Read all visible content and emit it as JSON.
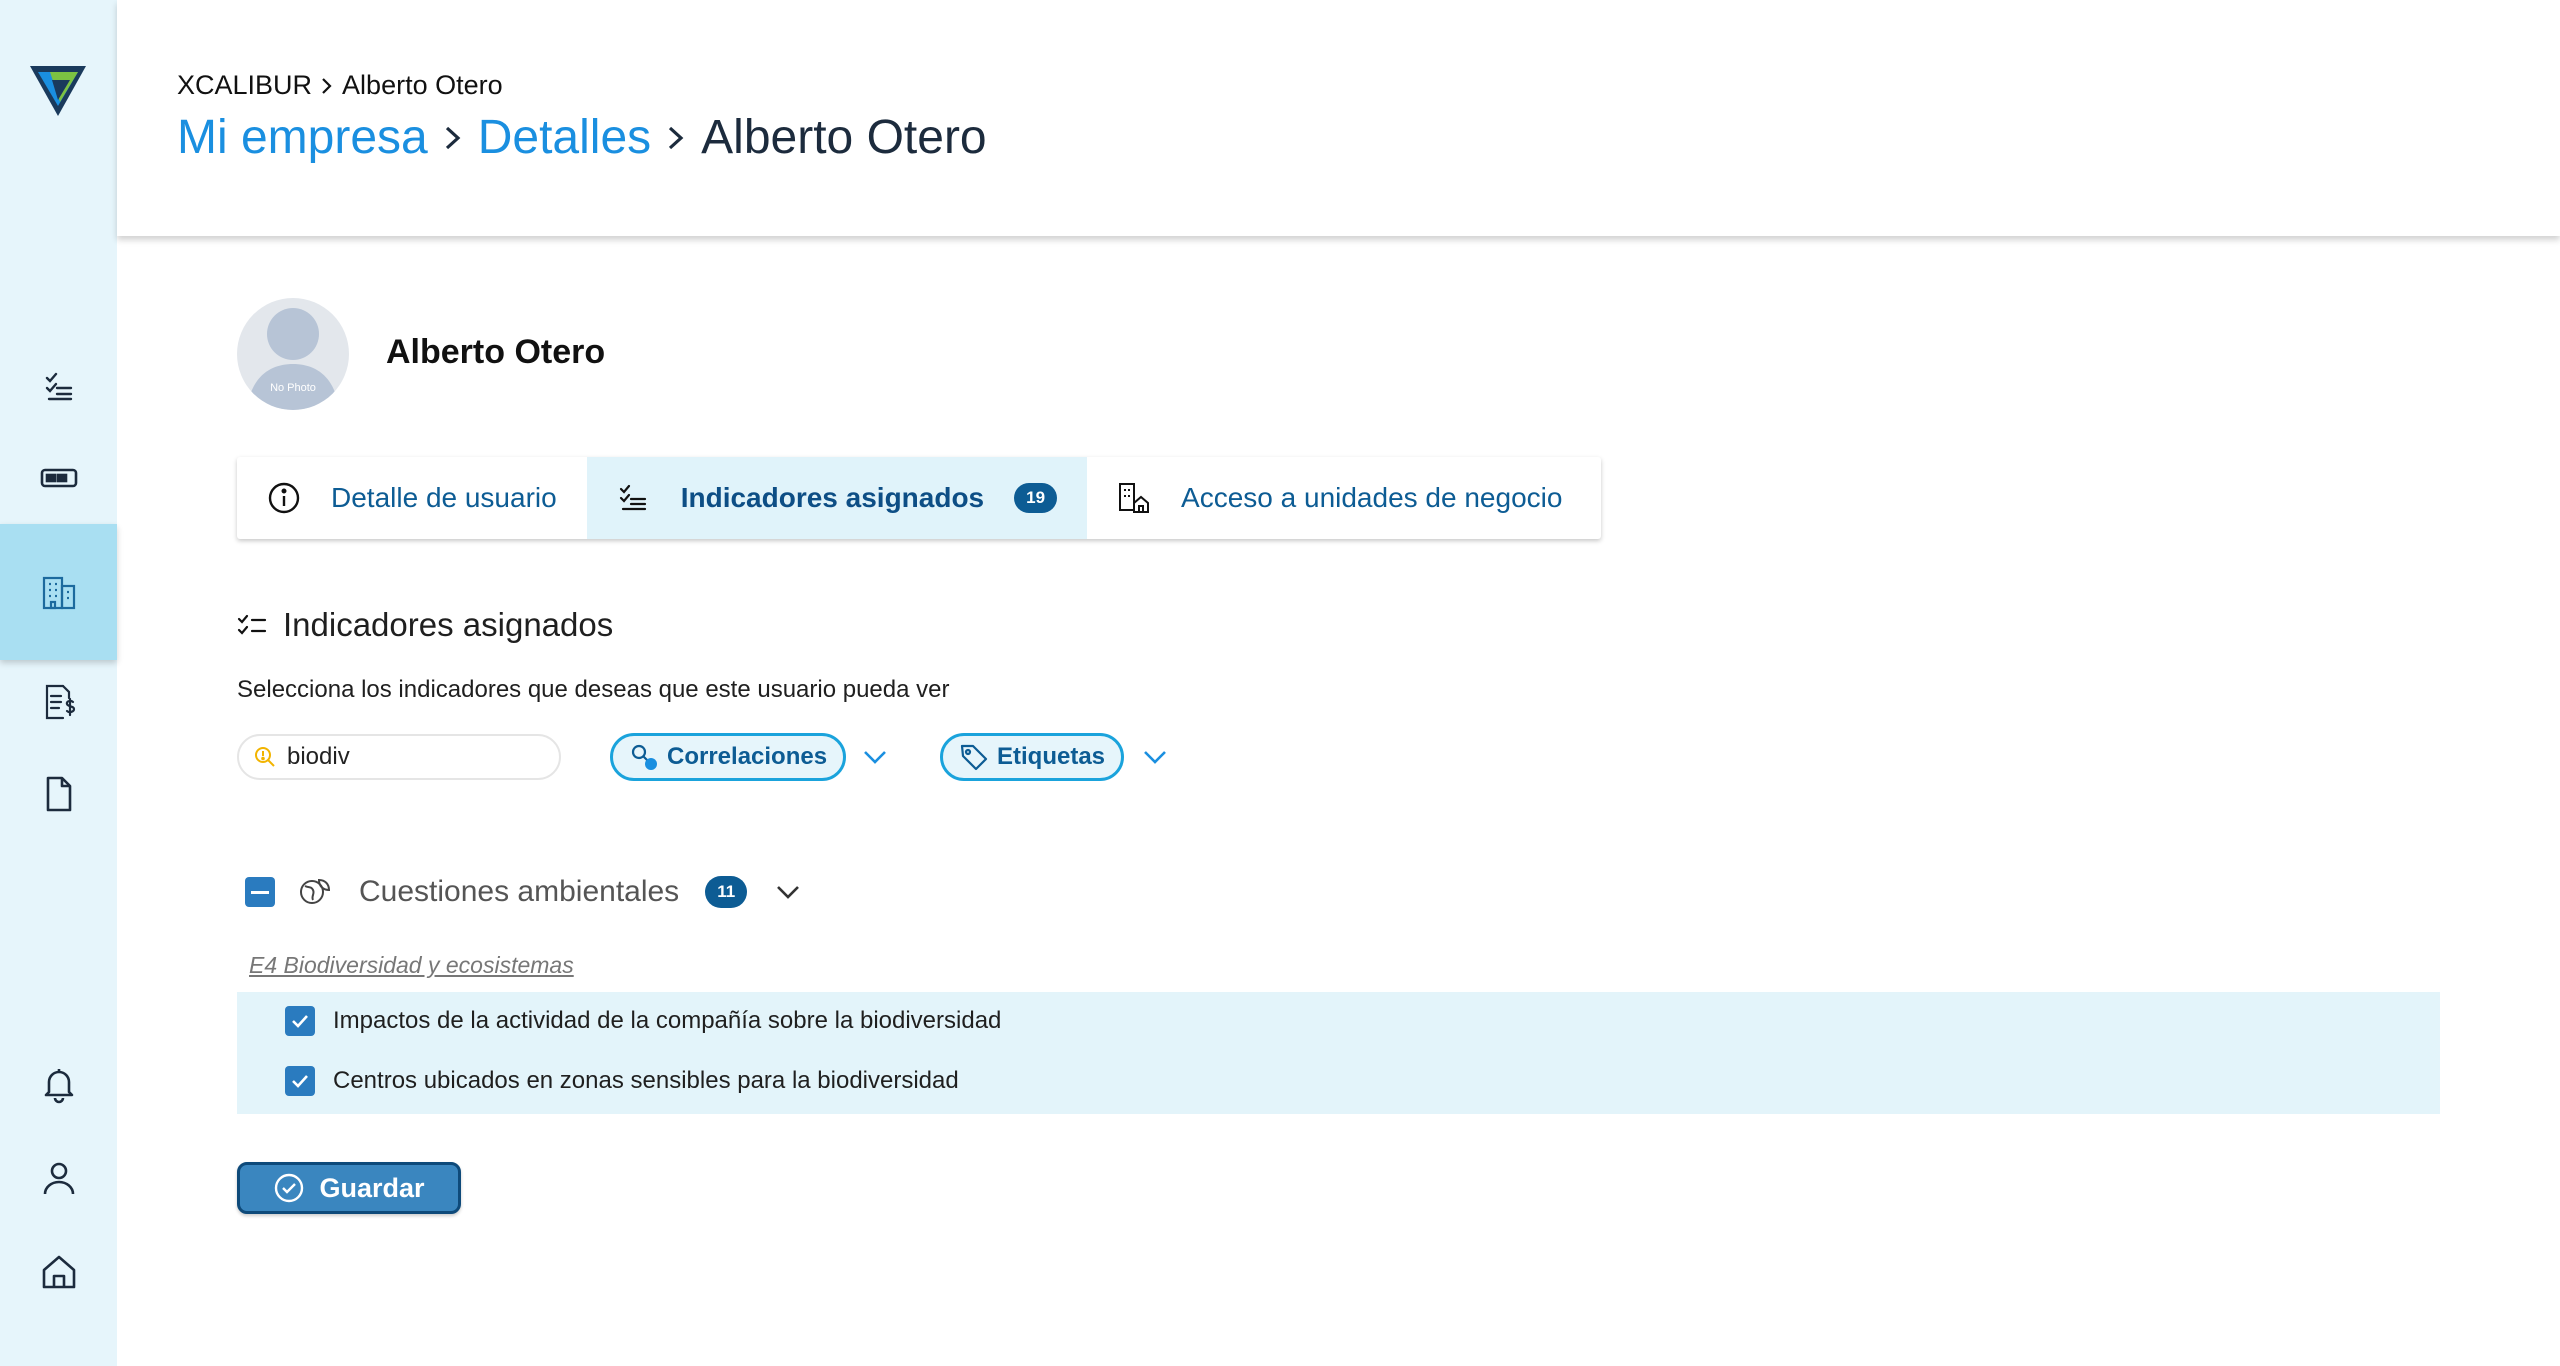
{
  "header": {
    "small_breadcrumb": [
      "XCALIBUR",
      "Alberto Otero"
    ],
    "big_breadcrumb": [
      "Mi empresa",
      "Detalles",
      "Alberto Otero"
    ]
  },
  "sidebar": {
    "logo": "logo-icon",
    "items": [
      {
        "icon": "checklist-icon",
        "active": false
      },
      {
        "icon": "card-icon",
        "active": false
      },
      {
        "icon": "building-icon",
        "active": true
      },
      {
        "icon": "invoice-icon",
        "active": false
      },
      {
        "icon": "document-icon",
        "active": false
      },
      {
        "icon": "bell-icon",
        "active": false
      },
      {
        "icon": "user-icon",
        "active": false
      },
      {
        "icon": "home-icon",
        "active": false
      }
    ]
  },
  "profile": {
    "name": "Alberto Otero",
    "avatar_text": "No Photo"
  },
  "tabs": [
    {
      "label": "Detalle de usuario",
      "icon": "info-icon",
      "active": false
    },
    {
      "label": "Indicadores asignados",
      "icon": "checklist-icon",
      "active": true,
      "badge": "19"
    },
    {
      "label": "Acceso a unidades de negocio",
      "icon": "building-home-icon",
      "active": false
    }
  ],
  "section": {
    "title": "Indicadores asignados",
    "subtitle": "Selecciona los indicadores que deseas que este usuario pueda ver"
  },
  "filters": {
    "search_value": "biodiv",
    "correlaciones_label": "Correlaciones",
    "etiquetas_label": "Etiquetas"
  },
  "group": {
    "label": "Cuestiones ambientales",
    "count": "11",
    "subcategory": "E4 Biodiversidad y ecosistemas",
    "items": [
      {
        "label": "Impactos de la actividad de la compañía sobre la biodiversidad",
        "checked": true
      },
      {
        "label": "Centros ubicados en zonas sensibles para la biodiversidad",
        "checked": true
      }
    ]
  },
  "actions": {
    "save_label": "Guardar"
  },
  "colors": {
    "sidebar_bg": "#e6f5fb",
    "sidebar_active": "#a9dff2",
    "link_blue": "#1a8fe0",
    "primary_dark": "#0d5c94",
    "checkbox": "#2a7bbf",
    "pill_border": "#1aa3dc",
    "row_highlight": "#e3f4fa",
    "save_button": "#3a86bf"
  }
}
